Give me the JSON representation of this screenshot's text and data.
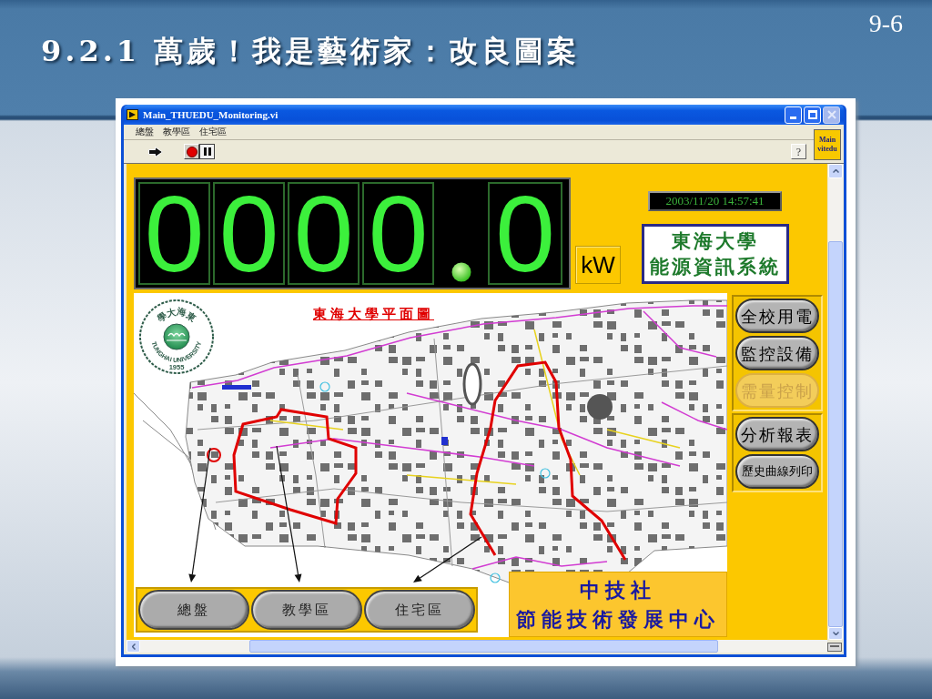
{
  "slide": {
    "title": "9.2.1 萬歲！我是藝術家：改良圖案",
    "page_number": "9-6"
  },
  "window": {
    "title": "Main_THUEDU_Monitoring.vi",
    "controls": [
      {
        "kind": "minimize",
        "disabled": false
      },
      {
        "kind": "maximize",
        "disabled": false
      },
      {
        "kind": "close",
        "disabled": true
      }
    ]
  },
  "menu": [
    "總盤",
    "教學區",
    "住宅區"
  ],
  "toolbar": [
    {
      "kind": "run"
    },
    {
      "kind": "stop"
    },
    {
      "kind": "pause"
    },
    {
      "kind": "help",
      "label": "?"
    }
  ],
  "vi_icon": [
    "Main",
    "vitedu"
  ],
  "power_display": {
    "integer_digits": [
      "0",
      "0",
      "0",
      "0"
    ],
    "fraction_digits": [
      "0"
    ],
    "unit": "kW"
  },
  "clock": "2003/11/20 14:57:41",
  "system_title": [
    "東海大學",
    "能源資訊系統"
  ],
  "map": {
    "logo": {
      "top_text": "東海大學",
      "bottom_text": "TUNGHAI UNIVERSITY",
      "year": "1955"
    },
    "title": "東海大學平面圖",
    "zone_buttons": [
      "總盤",
      "教學區",
      "住宅區"
    ]
  },
  "sponsor": [
    "中技社",
    "節能技術發展中心"
  ],
  "function_panels": [
    [
      {
        "label": "全校用電",
        "disabled": false
      },
      {
        "label": "監控設備",
        "disabled": false
      },
      {
        "label": "需量控制",
        "disabled": true
      }
    ],
    [
      {
        "label": "分析報表",
        "disabled": false
      },
      {
        "label": "歷史曲線列印",
        "disabled": false
      }
    ]
  ]
}
